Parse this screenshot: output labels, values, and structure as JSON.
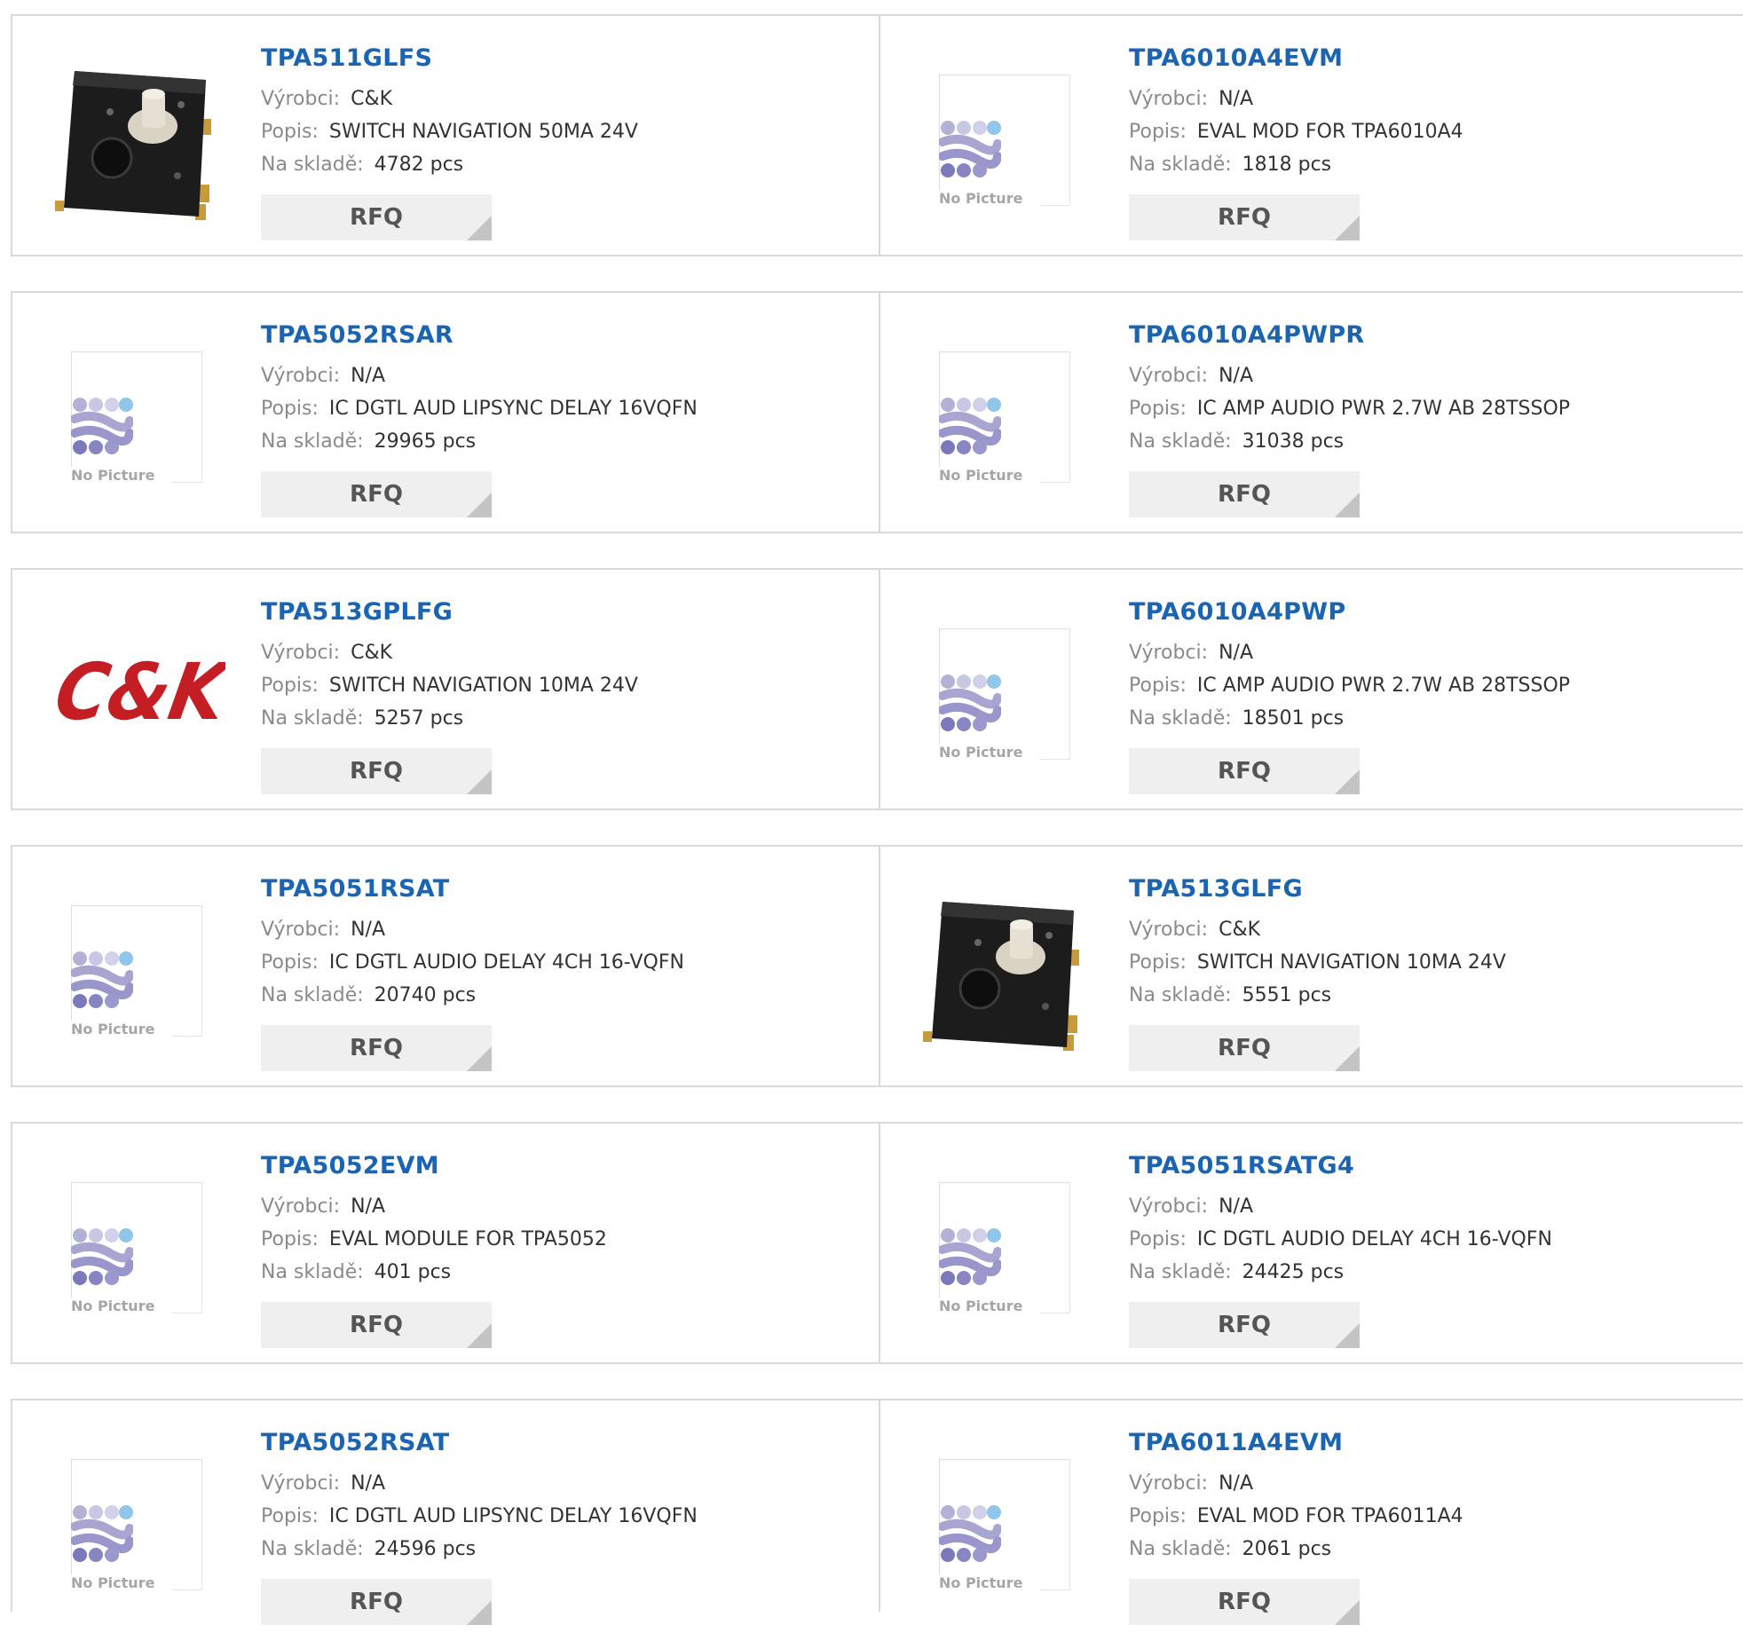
{
  "labels": {
    "manufacturer": "Výrobci:",
    "description": "Popis:",
    "stock": "Na skladě:",
    "rfq": "RFQ",
    "no_picture": "No Picture"
  },
  "colors": {
    "part_link": "#1a64b4",
    "button_bg": "#efefef",
    "ck_logo_red": "#c41e24"
  },
  "products": [
    {
      "part": "TPA511GLFS",
      "manufacturer": "C&K",
      "description": "SWITCH NAVIGATION 50MA 24V",
      "stock": "4782 pcs",
      "image": "switch-photo"
    },
    {
      "part": "TPA6010A4EVM",
      "manufacturer": "N/A",
      "description": "EVAL MOD FOR TPA6010A4",
      "stock": "1818 pcs",
      "image": "no-picture"
    },
    {
      "part": "TPA5052RSAR",
      "manufacturer": "N/A",
      "description": "IC DGTL AUD LIPSYNC DELAY 16VQFN",
      "stock": "29965 pcs",
      "image": "no-picture"
    },
    {
      "part": "TPA6010A4PWPR",
      "manufacturer": "N/A",
      "description": "IC AMP AUDIO PWR 2.7W AB 28TSSOP",
      "stock": "31038 pcs",
      "image": "no-picture"
    },
    {
      "part": "TPA513GPLFG",
      "manufacturer": "C&K",
      "description": "SWITCH NAVIGATION 10MA 24V",
      "stock": "5257 pcs",
      "image": "ck-logo",
      "logo_text": "C&K"
    },
    {
      "part": "TPA6010A4PWP",
      "manufacturer": "N/A",
      "description": "IC AMP AUDIO PWR 2.7W AB 28TSSOP",
      "stock": "18501 pcs",
      "image": "no-picture"
    },
    {
      "part": "TPA5051RSAT",
      "manufacturer": "N/A",
      "description": "IC DGTL AUDIO DELAY 4CH 16-VQFN",
      "stock": "20740 pcs",
      "image": "no-picture"
    },
    {
      "part": "TPA513GLFG",
      "manufacturer": "C&K",
      "description": "SWITCH NAVIGATION 10MA 24V",
      "stock": "5551 pcs",
      "image": "switch-photo"
    },
    {
      "part": "TPA5052EVM",
      "manufacturer": "N/A",
      "description": "EVAL MODULE FOR TPA5052",
      "stock": "401 pcs",
      "image": "no-picture"
    },
    {
      "part": "TPA5051RSATG4",
      "manufacturer": "N/A",
      "description": "IC DGTL AUDIO DELAY 4CH 16-VQFN",
      "stock": "24425 pcs",
      "image": "no-picture"
    },
    {
      "part": "TPA5052RSAT",
      "manufacturer": "N/A",
      "description": "IC DGTL AUD LIPSYNC DELAY 16VQFN",
      "stock": "24596 pcs",
      "image": "no-picture"
    },
    {
      "part": "TPA6011A4EVM",
      "manufacturer": "N/A",
      "description": "EVAL MOD FOR TPA6011A4",
      "stock": "2061 pcs",
      "image": "no-picture"
    }
  ]
}
